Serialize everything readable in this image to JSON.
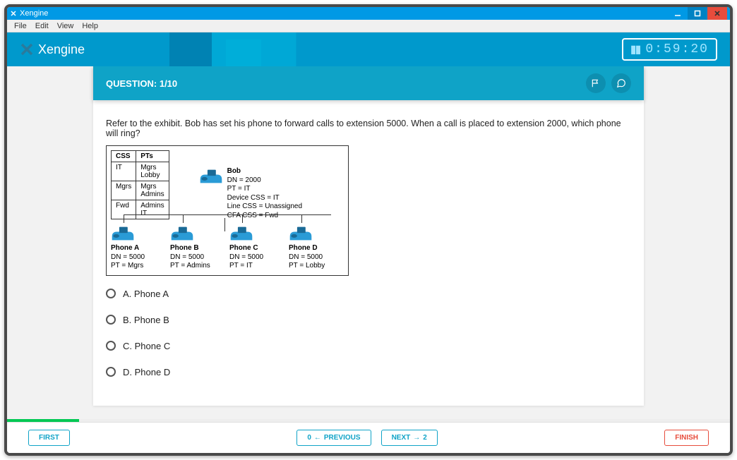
{
  "titlebar": {
    "title": "Xengine"
  },
  "menubar": {
    "items": [
      "File",
      "Edit",
      "View",
      "Help"
    ]
  },
  "app": {
    "title": "Xengine"
  },
  "timer": {
    "value": "0:59:20"
  },
  "question_header": {
    "label": "QUESTION: 1/10"
  },
  "question": {
    "text": "Refer to the exhibit. Bob has set his phone to forward calls to extension 5000. When a call is placed to extension 2000, which phone will ring?"
  },
  "exhibit": {
    "css_table": {
      "headers": [
        "CSS",
        "PTs"
      ],
      "rows": [
        [
          "IT",
          "Mgrs\nLobby"
        ],
        [
          "Mgrs",
          "Mgrs\nAdmins"
        ],
        [
          "Fwd",
          "Admins\nIT"
        ]
      ]
    },
    "bob": {
      "name": "Bob",
      "lines": [
        "DN = 2000",
        "PT = IT",
        "Device CSS = IT",
        "Line CSS = Unassigned",
        "CFA CSS = Fwd"
      ]
    },
    "phones": [
      {
        "name": "Phone A",
        "dn": "DN = 5000",
        "pt": "PT = Mgrs"
      },
      {
        "name": "Phone B",
        "dn": "DN = 5000",
        "pt": "PT = Admins"
      },
      {
        "name": "Phone C",
        "dn": "DN = 5000",
        "pt": "PT = IT"
      },
      {
        "name": "Phone D",
        "dn": "DN = 5000",
        "pt": "PT = Lobby"
      }
    ]
  },
  "answers": [
    {
      "label": "A. Phone A"
    },
    {
      "label": "B. Phone B"
    },
    {
      "label": "C. Phone C"
    },
    {
      "label": "D. Phone D"
    }
  ],
  "footer": {
    "first": "FIRST",
    "previous": "PREVIOUS",
    "prev_num": "0",
    "next": "NEXT",
    "next_num": "2",
    "finish": "FINISH"
  }
}
